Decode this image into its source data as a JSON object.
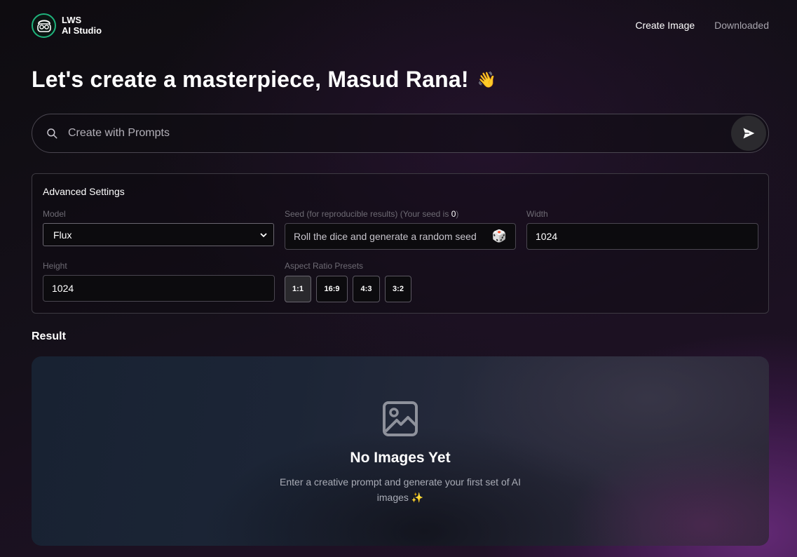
{
  "brand": {
    "line1": "LWS",
    "line2": "AI Studio",
    "logo_icon": "glasses-face-icon",
    "accent": "#1fb37c"
  },
  "nav": {
    "create_image": "Create Image",
    "downloaded": "Downloaded"
  },
  "greeting": {
    "text": "Let's create a masterpiece, Masud Rana!",
    "emoji": "👋"
  },
  "prompt": {
    "placeholder": "Create with Prompts",
    "value": ""
  },
  "settings": {
    "title": "Advanced Settings",
    "model": {
      "label": "Model",
      "selected": "Flux"
    },
    "seed": {
      "label_prefix": "Seed (for reproducible results) (Your seed is ",
      "seed_value": "0",
      "label_suffix": ")",
      "placeholder": "Roll the dice and generate a random seed",
      "dice": "🎲"
    },
    "width": {
      "label": "Width",
      "value": "1024"
    },
    "height": {
      "label": "Height",
      "value": "1024"
    },
    "aspect": {
      "label": "Aspect Ratio Presets",
      "presets": [
        "1:1",
        "16:9",
        "4:3",
        "3:2"
      ],
      "active": "1:1"
    }
  },
  "result": {
    "label": "Result",
    "empty_title": "No Images Yet",
    "empty_desc": "Enter a creative prompt and generate your first set of AI images",
    "empty_emoji": "✨"
  }
}
